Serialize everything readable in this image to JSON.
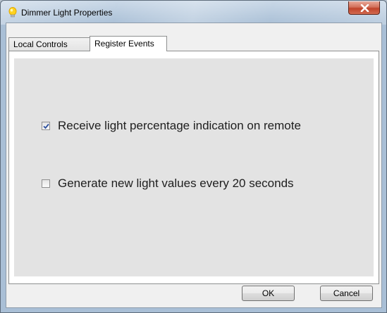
{
  "window": {
    "title": "Dimmer Light Properties",
    "icon": "lightbulb-icon",
    "close_icon": "close-icon"
  },
  "tabs": [
    {
      "label": "Local Controls",
      "selected": false
    },
    {
      "label": "Register Events",
      "selected": true
    }
  ],
  "options": [
    {
      "label": "Receive light percentage indication on remote",
      "checked": true
    },
    {
      "label": "Generate new light values every 20 seconds",
      "checked": false
    }
  ],
  "buttons": {
    "ok_label": "OK",
    "cancel_label": "Cancel"
  },
  "colors": {
    "accent_check": "#2b4f9e",
    "close_red": "#c0432a",
    "panel_gray": "#e3e3e3"
  }
}
